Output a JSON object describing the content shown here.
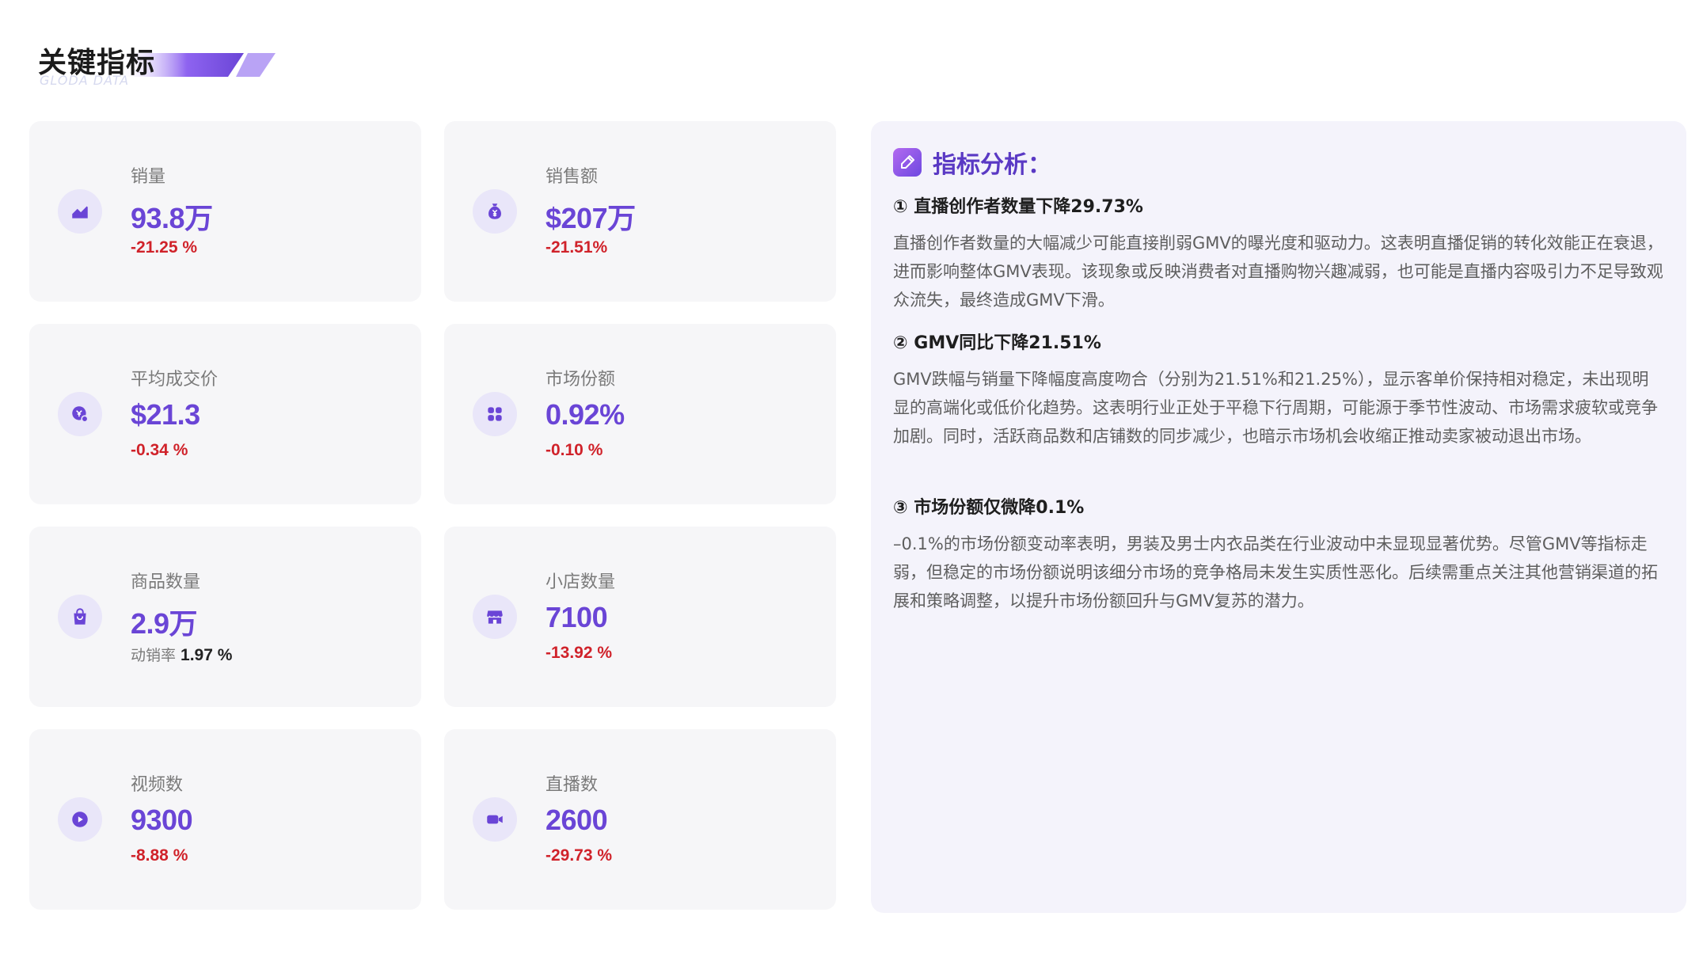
{
  "header": {
    "title": "关键指标",
    "subtitle": "GLODA DATA"
  },
  "metrics": [
    {
      "label": "销量",
      "value": "93.8万",
      "change": "-21.25 %",
      "icon": "trend-chart-icon"
    },
    {
      "label": "销售额",
      "value": "$207万",
      "change": "-21.51%",
      "icon": "money-bag-icon"
    },
    {
      "label": "平均成交价",
      "value": "$21.3",
      "change": "-0.34 %",
      "icon": "price-tag-icon"
    },
    {
      "label": "市场份额",
      "value": "0.92%",
      "change": "-0.10 %",
      "icon": "grid-apps-icon"
    },
    {
      "label": "商品数量",
      "value": "2.9万",
      "sub_label": "动销率",
      "sub_value": "1.97 %",
      "icon": "shopping-bag-icon"
    },
    {
      "label": "小店数量",
      "value": "7100",
      "change": "-13.92 %",
      "icon": "store-icon"
    },
    {
      "label": "视频数",
      "value": "9300",
      "change": "-8.88 %",
      "icon": "play-icon"
    },
    {
      "label": "直播数",
      "value": "2600",
      "change": "-29.73 %",
      "icon": "video-camera-icon"
    }
  ],
  "analysis": {
    "title": "指标分析：",
    "sections": [
      {
        "title": "① 直播创作者数量下降29.73%",
        "body": "直播创作者数量的大幅减少可能直接削弱GMV的曝光度和驱动力。这表明直播促销的转化效能正在衰退，进而影响整体GMV表现。该现象或反映消费者对直播购物兴趣减弱，也可能是直播内容吸引力不足导致观众流失，最终造成GMV下滑。"
      },
      {
        "title": "② GMV同比下降21.51%",
        "body": "GMV跌幅与销量下降幅度高度吻合（分别为21.51%和21.25%），显示客单价保持相对稳定，未出现明显的高端化或低价化趋势。这表明行业正处于平稳下行周期，可能源于季节性波动、市场需求疲软或竞争加剧。同时，活跃商品数和店铺数的同步减少，也暗示市场机会收缩正推动卖家被动退出市场。"
      },
      {
        "title": "③ 市场份额仅微降0.1%",
        "body": "–0.1%的市场份额变动率表明，男装及男士内衣品类在行业波动中未显现显著优势。尽管GMV等指标走弱，但稳定的市场份额说明该细分市场的竞争格局未发生实质性恶化。后续需重点关注其他营销渠道的拓展和策略调整，以提升市场份额回升与GMV复苏的潜力。"
      }
    ]
  },
  "colors": {
    "accent": "#6a45d6",
    "negative": "#d0222a",
    "card_bg": "#f6f6f8",
    "panel_bg": "#f4f3fb",
    "icon_bg": "#e9e6f9"
  }
}
